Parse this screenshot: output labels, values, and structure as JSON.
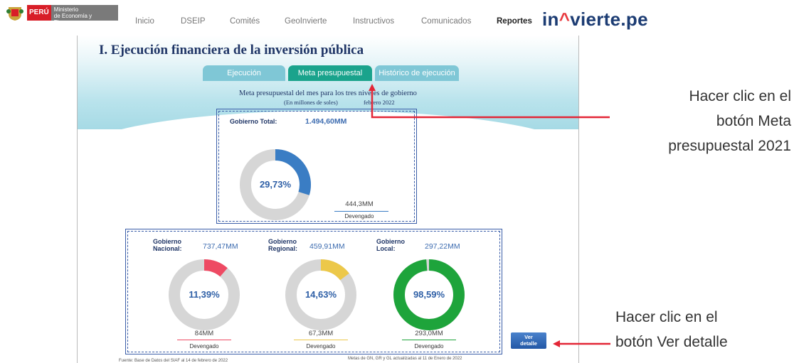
{
  "header": {
    "country": "PERÚ",
    "ministry_line1": "Ministerio",
    "ministry_line2": "de Economía y Finanzas",
    "nav": [
      "Inicio",
      "DSEIP",
      "Comités",
      "GeoInvierte",
      "Instructivos",
      "Comunicados",
      "Reportes"
    ],
    "brand": "inviertepe",
    "brand_pre": "in",
    "brand_caret": "^",
    "brand_post": "vierte.pe"
  },
  "page": {
    "title": "I. Ejecución financiera de la inversión pública",
    "tabs": [
      "Ejecución",
      "Meta presupuestal",
      "Histórico de ejecución"
    ],
    "active_tab": "Meta presupuestal",
    "subtitle": "Meta presupuestal del mes para los tres niveles de gobierno",
    "units": "(En millones de soles)",
    "period": "febrero   2022"
  },
  "total": {
    "label": "Gobierno Total:",
    "amount": "1.494,60MM",
    "percent": "29,73%",
    "devengado_amount": "444,3MM",
    "devengado_label": "Devengado",
    "fraction": 0.2973,
    "color": "#3a7dc4"
  },
  "levels": [
    {
      "label1": "Gobierno",
      "label2": "Nacional:",
      "amount": "737,47MM",
      "percent": "11,39%",
      "devengado_amount": "84MM",
      "devengado_label": "Devengado",
      "fraction": 0.1139,
      "color": "#ee4a63"
    },
    {
      "label1": "Gobierno",
      "label2": "Regional:",
      "amount": "459,91MM",
      "percent": "14,63%",
      "devengado_amount": "67,3MM",
      "devengado_label": "Devengado",
      "fraction": 0.1463,
      "color": "#ecc84a"
    },
    {
      "label1": "Gobierno",
      "label2": "Local:",
      "amount": "297,22MM",
      "percent": "98,59%",
      "devengado_amount": "293,0MM",
      "devengado_label": "Devengado",
      "fraction": 0.9859,
      "color": "#1ea43b"
    }
  ],
  "ver_detalle": {
    "line1": "Ver",
    "line2": "detalle"
  },
  "footer": {
    "source": "Fuente: Base de Datos del SIAF al 14 de febrero de 2022",
    "note": "Metas de GN, GR y GL actualizadas al 11 de Enero de 2022"
  },
  "annotations": {
    "meta": [
      "Hacer clic en el",
      "botón Meta",
      "presupuestal 2021"
    ],
    "detalle": [
      "Hacer clic en el",
      "botón Ver detalle"
    ],
    "arrow_color": "#e32636"
  }
}
